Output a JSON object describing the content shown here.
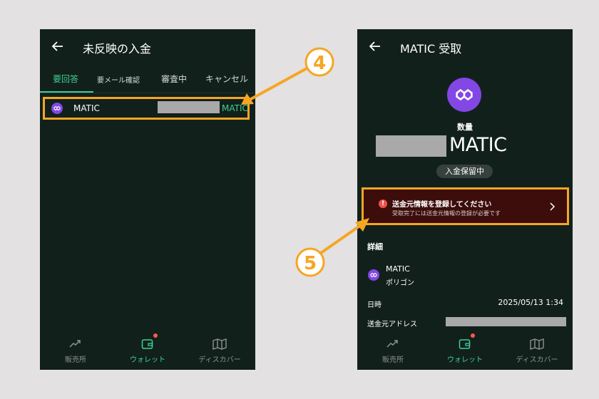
{
  "left": {
    "title": "未反映の入金",
    "tabs": [
      "要回答",
      "要メール確認",
      "審査中",
      "キャンセル"
    ],
    "row": {
      "name": "MATIC",
      "unit": "MATIC"
    }
  },
  "right": {
    "title": "MATIC 受取",
    "qty_label": "数量",
    "amount_unit": "MATIC",
    "status_badge": "入金保留中",
    "alert": {
      "icon": "!",
      "title": "送金元情報を登録してください",
      "subtitle": "受取完了には送金元情報の登録が必要です"
    },
    "details_title": "詳細",
    "coin": {
      "name": "MATIC",
      "sub": "ポリゴン"
    },
    "date_label": "日時",
    "date_value": "2025/05/13 1:34",
    "address_label": "送金元アドレス"
  },
  "nav": [
    {
      "label": "販売所",
      "icon": "trend-up-icon"
    },
    {
      "label": "ウォレット",
      "icon": "wallet-icon"
    },
    {
      "label": "ディスカバー",
      "icon": "map-icon"
    }
  ],
  "annotations": {
    "step4": "4",
    "step5": "5"
  },
  "colors": {
    "bg": "#12201c",
    "accent": "#3fcf93",
    "highlight": "#f5a623",
    "polygon": "#8247e5",
    "alert_bg": "#3c0d0b"
  }
}
